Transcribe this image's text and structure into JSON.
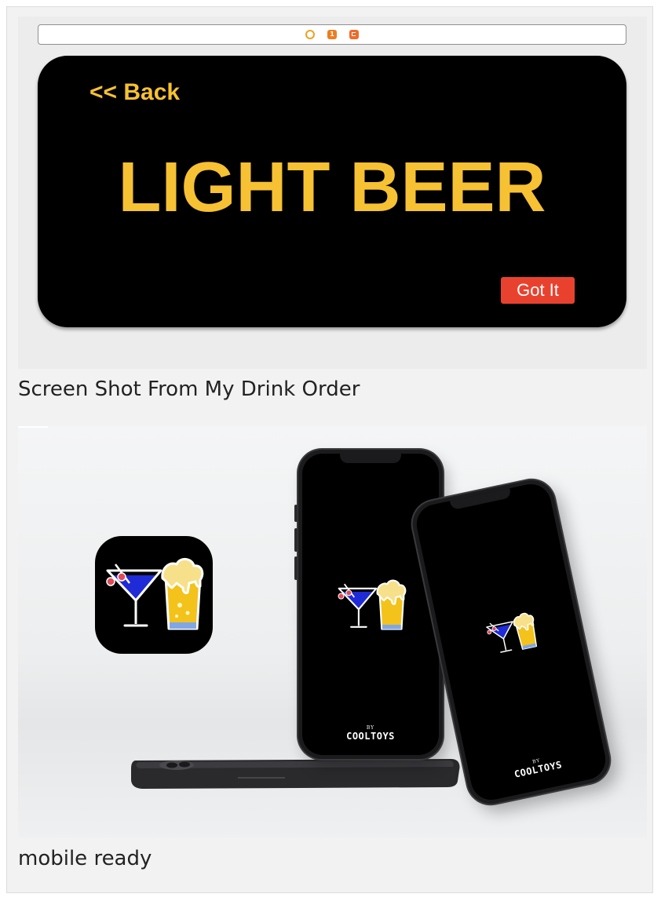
{
  "storyboard": {
    "scene_bar_icons": [
      "view-controller-icon",
      "first-responder-icon",
      "exit-icon"
    ],
    "scene_bar_badge": "1",
    "back_label": "<< Back",
    "title": "LIGHT BEER",
    "got_it_label": "Got It",
    "colors": {
      "accent": "#f6c133",
      "button": "#e8422f",
      "screen": "#000000"
    }
  },
  "captions": {
    "first": "Screen Shot From My Drink Order",
    "second": "mobile ready"
  },
  "mockup": {
    "brand_by": "BY",
    "brand_name": "COOLTOYS",
    "icons": [
      "cocktail-glass-icon",
      "beer-glass-icon"
    ]
  }
}
